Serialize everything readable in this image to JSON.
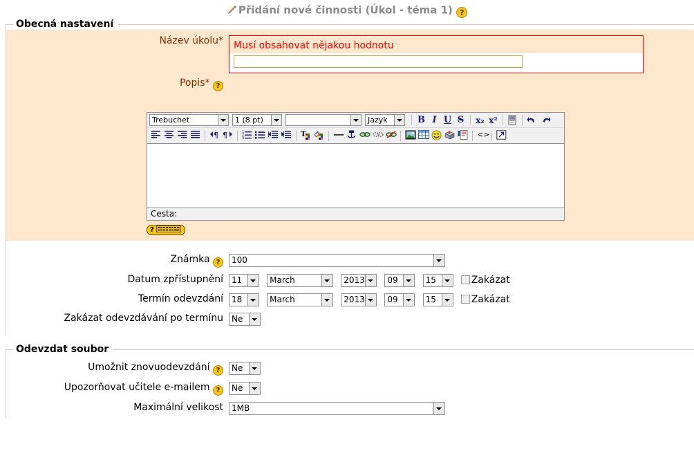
{
  "page": {
    "heading": "Přidání nové činnosti (Úkol - téma 1)",
    "heading_help_icon": "help-icon",
    "edit_icon": "edit-pencil-icon"
  },
  "general_section": {
    "legend": "Obecná nastavení",
    "name_field": {
      "label": "Název úkolu*",
      "error_message": "Musí obsahovat nějakou hodnotu",
      "value": "",
      "placeholder": ""
    },
    "description_field": {
      "label": "Popis*",
      "help_icon": "help-icon"
    },
    "grade": {
      "label": "Známka",
      "help_icon": "help-icon",
      "value": "100"
    },
    "available_from": {
      "label": "Datum zpřístupnění",
      "day": "11",
      "month": "March",
      "year": "2013",
      "hour": "09",
      "minute": "15",
      "disable_label": "Zakázat",
      "disable_checked": false
    },
    "due_date": {
      "label": "Termín odevzdání",
      "day": "18",
      "month": "March",
      "year": "2013",
      "hour": "09",
      "minute": "15",
      "disable_label": "Zakázat",
      "disable_checked": false
    },
    "prevent_late": {
      "label": "Zakázat odevzdávání po termínu",
      "value": "Ne"
    }
  },
  "editor": {
    "font_family": "Trebuchet",
    "font_size": "1 (8 pt)",
    "format": "",
    "language": "Jazyk",
    "status_label": "Cesta:",
    "content": "",
    "toolbar_row1": [
      {
        "name": "bold-button",
        "glyph": "B"
      },
      {
        "name": "italic-button",
        "glyph": "I"
      },
      {
        "name": "underline-button",
        "glyph": "U"
      },
      {
        "name": "strikethrough-button",
        "glyph": "S"
      },
      {
        "name": "subscript-button",
        "glyph": "x₂"
      },
      {
        "name": "superscript-button",
        "glyph": "x²"
      },
      {
        "name": "cleanup-html-button",
        "glyph": "cleanup-icon"
      },
      {
        "name": "undo-button",
        "glyph": "undo-icon"
      },
      {
        "name": "redo-button",
        "glyph": "redo-icon"
      }
    ],
    "toolbar_row2": [
      {
        "name": "align-left-button"
      },
      {
        "name": "align-center-button"
      },
      {
        "name": "align-right-button"
      },
      {
        "name": "align-justify-button"
      },
      {
        "name": "direction-ltr-button"
      },
      {
        "name": "direction-rtl-button"
      },
      {
        "name": "ordered-list-button"
      },
      {
        "name": "unordered-list-button"
      },
      {
        "name": "outdent-button"
      },
      {
        "name": "indent-button"
      },
      {
        "name": "font-color-button"
      },
      {
        "name": "background-color-button"
      },
      {
        "name": "horizontal-rule-button"
      },
      {
        "name": "anchor-button"
      },
      {
        "name": "insert-link-button"
      },
      {
        "name": "unlink-button"
      },
      {
        "name": "remove-link-button"
      },
      {
        "name": "insert-image-button"
      },
      {
        "name": "insert-table-button"
      },
      {
        "name": "insert-emoticon-button"
      },
      {
        "name": "insert-media-button"
      },
      {
        "name": "insert-file-button"
      },
      {
        "name": "html-source-button"
      },
      {
        "name": "fullscreen-button"
      }
    ],
    "keyboard_help_button": {
      "name": "keyboard-help-button",
      "glyph": "?",
      "icon": "keyboard-icon"
    }
  },
  "upload_section": {
    "legend": "Odevzdat soubor",
    "allow_resubmit": {
      "label": "Umožnit znovuodevzdání",
      "help_icon": "help-icon",
      "value": "Ne"
    },
    "email_alerts": {
      "label": "Upozorňovat učitele e-mailem",
      "help_icon": "help-icon",
      "value": "Ne"
    },
    "max_size": {
      "label": "Maximální velikost",
      "value": "1MB"
    }
  },
  "colors": {
    "shade": "#fde8cd",
    "error": "#ff0000",
    "label_required": "#8b2e00",
    "heading": "#8a8a8a",
    "help_badge": "#f5c518"
  }
}
